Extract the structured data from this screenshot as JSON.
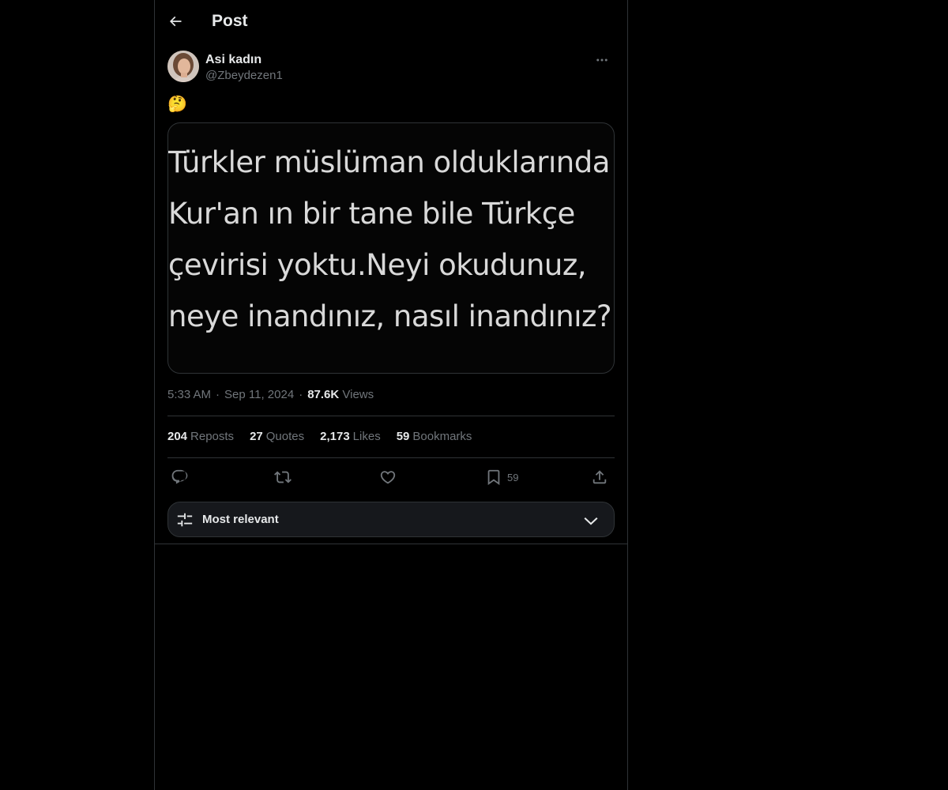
{
  "header": {
    "title": "Post",
    "back_icon": "arrow-left-icon"
  },
  "author": {
    "display_name": "Asi kadın",
    "handle": "@Zbeydezen1",
    "more_icon": "more-horizontal-icon"
  },
  "tweet": {
    "text": "🤔",
    "image_text": [
      "Türkler müslüman olduklarında",
      "Kur'an ın bir tane bile Türkçe",
      "çevirisi yoktu.Neyi okudunuz,",
      "neye inandınız, nasıl inandınız?"
    ]
  },
  "meta": {
    "time": "5:33 AM",
    "separator": "·",
    "date": "Sep 11, 2024",
    "views_count": "87.6K",
    "views_label": "Views"
  },
  "stats": {
    "reposts": {
      "count": "204",
      "label": "Reposts"
    },
    "quotes": {
      "count": "27",
      "label": "Quotes"
    },
    "likes": {
      "count": "2,173",
      "label": "Likes"
    },
    "bookmarks": {
      "count": "59",
      "label": "Bookmarks"
    }
  },
  "actions": {
    "reply_icon": "reply-icon",
    "repost_icon": "repost-icon",
    "like_icon": "like-icon",
    "bookmark_icon": "bookmark-icon",
    "bookmark_count": "59",
    "share_icon": "share-icon"
  },
  "sort": {
    "label": "Most relevant",
    "icon": "sliders-icon",
    "chevron": "chevron-down-icon"
  },
  "colors": {
    "background": "#000000",
    "text_primary": "#e7e9ea",
    "text_secondary": "#71767b",
    "border": "#2f3336",
    "sort_bar_bg": "#16181c"
  }
}
